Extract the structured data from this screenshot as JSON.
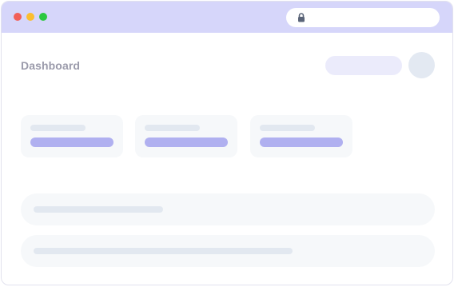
{
  "window": {
    "title_bar_color": "#d6d6fa",
    "traffic_lights": [
      {
        "name": "close",
        "color": "#f25f58"
      },
      {
        "name": "minimize",
        "color": "#fbbe2e"
      },
      {
        "name": "maximize",
        "color": "#2bc840"
      }
    ],
    "address_bar": {
      "icon": "lock-icon",
      "value": ""
    }
  },
  "header": {
    "title": "Dashboard"
  },
  "stat_cards": [
    {
      "name": "stat-card-1"
    },
    {
      "name": "stat-card-2"
    },
    {
      "name": "stat-card-3"
    }
  ],
  "list_rows": [
    {
      "name": "list-row-1"
    },
    {
      "name": "list-row-2"
    }
  ],
  "colors": {
    "accent": "#b0b0f0",
    "placeholder": "#e2e8f0",
    "card_background": "#f6f8fa",
    "title_text": "#9a9aaa"
  }
}
